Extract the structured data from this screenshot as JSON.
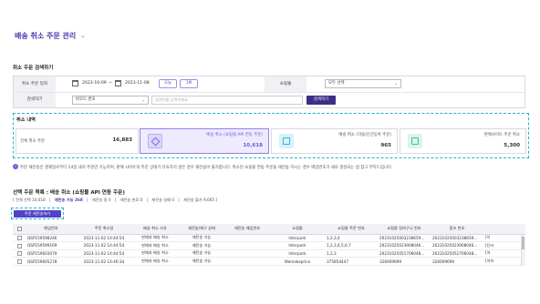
{
  "page": {
    "title": "배송 취소 주문 관리",
    "chevron": "⌄"
  },
  "search": {
    "title": "취소 주문 검색하기",
    "date_label": "취소 주문 일자",
    "date_from": "2023-10-09",
    "date_sep": "~",
    "date_to": "2023-11-08",
    "today_label": "오늘",
    "month_label": "1M",
    "mall_label": "쇼핑몰",
    "mall_value": "모두 선택",
    "keyword_label": "검색하기",
    "keyword_type": "바코드 번호",
    "keyword_placeholder": "검색어를 입력하세요",
    "search_button": "검색하기"
  },
  "cancel_summary": {
    "title": "취소 내역",
    "total_label": "전체 취소 주문",
    "total_value": "16,883",
    "cards": [
      {
        "label": "배송 취소 (쇼핑몰 API 연동 주문)",
        "value": "10,618",
        "icon": "box-icon",
        "color": "#7b6cdc"
      },
      {
        "label": "배송 취소 (막을/단건등록 주문)",
        "value": "965",
        "icon": "list-icon",
        "color": "#38b7d4"
      },
      {
        "label": "판매사이트 주문 취소",
        "value": "5,300",
        "icon": "cube-icon",
        "color": "#3bc48f"
      }
    ]
  },
  "info": {
    "icon": "info-icon",
    "text": "주문 재전송은 결제일로부터 14일 내의 주문만 가능하며, 판매 사이트의 주문 상태가 유효하지 않은 경우 재전송이 불가합니다. 취소된 쇼핑몰 연동 주문을 재전송 하시는 경우 매입번호가 새로 생성되는 점 참고 부탁드립니다."
  },
  "list": {
    "title": "선택 주문 목록 : 배송 취소 (쇼핑몰 API 연동 주문)",
    "filters": [
      {
        "label": "[ 전체 선택 10,618",
        "active": false
      },
      {
        "label": "|",
        "active": false
      },
      {
        "label": "재전송 가능 268",
        "active": true
      },
      {
        "label": "|",
        "active": false
      },
      {
        "label": "재전송 중 0",
        "active": false
      },
      {
        "label": "|",
        "active": false
      },
      {
        "label": "재전송 완료 0",
        "active": false
      },
      {
        "label": "|",
        "active": false
      },
      {
        "label": "재전송 실패 0",
        "active": false
      },
      {
        "label": "|",
        "active": false
      },
      {
        "label": "재전송 불가 9,665 ]",
        "active": false
      }
    ],
    "resend_button": "주문 재전송하기",
    "columns": [
      "",
      "매입번호",
      "주문 취소일",
      "배송 취소 사유",
      "재전송/재구 상태",
      "재전송 매입번호",
      "쇼핑몰",
      "쇼핑몰 주문 번호",
      "쇼핑몰 장바구니 번호",
      "접조 번호",
      ""
    ],
    "rows": [
      [
        "QSP159598246",
        "2023-11-02 14:44:54",
        "판매자 배송 취소",
        "재전송 가능",
        "",
        "Interpark",
        "1,2,3,4",
        "20231025003238659...",
        "20231025003238659...",
        "[이"
      ],
      [
        "QSP159599169",
        "2023-11-02 14:44:54",
        "판매자 배송 취소",
        "재전송 가능",
        "",
        "Interpark",
        "1,2,3,4,5,6,7",
        "20231025023908046...",
        "20231025023908046...",
        "[딘터"
      ],
      [
        "QSP159603079",
        "2023-11-02 14:44:54",
        "판매자 배송 취소",
        "재전송 가능",
        "",
        "Interpark",
        "1,2,3",
        "20231025051706048...",
        "20231025051706048...",
        "[어"
      ],
      [
        "QSP159605278",
        "2023-11-02 14:46:34",
        "판매자 배송 취소",
        "재전송 가능",
        "",
        "Wemakeprice",
        "375854447",
        "326009699",
        "326009699",
        "[어하"
      ]
    ]
  }
}
